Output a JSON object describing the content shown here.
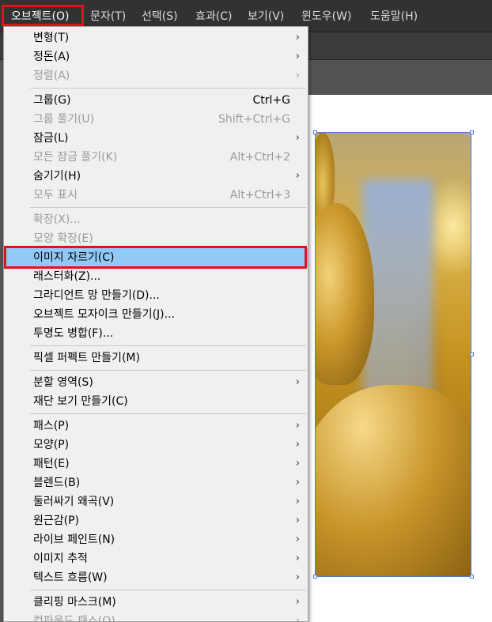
{
  "menubar": {
    "items": [
      {
        "label": "오브젝트(O)"
      },
      {
        "label": "문자(T)"
      },
      {
        "label": "선택(S)"
      },
      {
        "label": "효과(C)"
      },
      {
        "label": "보기(V)"
      },
      {
        "label": "윈도우(W)"
      },
      {
        "label": "도움말(H)"
      }
    ]
  },
  "object_menu": {
    "items": [
      {
        "label": "변형(T)",
        "shortcut": "",
        "submenu": true,
        "enabled": true
      },
      {
        "label": "정돈(A)",
        "shortcut": "",
        "submenu": true,
        "enabled": true
      },
      {
        "label": "정렬(A)",
        "shortcut": "",
        "submenu": true,
        "enabled": false
      },
      {
        "label": "그룹(G)",
        "shortcut": "Ctrl+G",
        "submenu": false,
        "enabled": true
      },
      {
        "label": "그룹 풀기(U)",
        "shortcut": "Shift+Ctrl+G",
        "submenu": false,
        "enabled": false
      },
      {
        "label": "잠금(L)",
        "shortcut": "",
        "submenu": true,
        "enabled": true
      },
      {
        "label": "모든 잠금 풀기(K)",
        "shortcut": "Alt+Ctrl+2",
        "submenu": false,
        "enabled": false
      },
      {
        "label": "숨기기(H)",
        "shortcut": "",
        "submenu": true,
        "enabled": true
      },
      {
        "label": "모두 표시",
        "shortcut": "Alt+Ctrl+3",
        "submenu": false,
        "enabled": false
      },
      {
        "label": "확장(X)...",
        "shortcut": "",
        "submenu": false,
        "enabled": false
      },
      {
        "label": "모양 확장(E)",
        "shortcut": "",
        "submenu": false,
        "enabled": false
      },
      {
        "label": "이미지 자르기(C)",
        "shortcut": "",
        "submenu": false,
        "enabled": true
      },
      {
        "label": "래스터화(Z)...",
        "shortcut": "",
        "submenu": false,
        "enabled": true
      },
      {
        "label": "그라디언트 망 만들기(D)...",
        "shortcut": "",
        "submenu": false,
        "enabled": true
      },
      {
        "label": "오브젝트 모자이크 만들기(J)...",
        "shortcut": "",
        "submenu": false,
        "enabled": true
      },
      {
        "label": "투명도 병합(F)...",
        "shortcut": "",
        "submenu": false,
        "enabled": true
      },
      {
        "label": "픽셀 퍼펙트 만들기(M)",
        "shortcut": "",
        "submenu": false,
        "enabled": true
      },
      {
        "label": "분할 영역(S)",
        "shortcut": "",
        "submenu": true,
        "enabled": true
      },
      {
        "label": "재단 보기 만들기(C)",
        "shortcut": "",
        "submenu": false,
        "enabled": true
      },
      {
        "label": "패스(P)",
        "shortcut": "",
        "submenu": true,
        "enabled": true
      },
      {
        "label": "모양(P)",
        "shortcut": "",
        "submenu": true,
        "enabled": true
      },
      {
        "label": "패턴(E)",
        "shortcut": "",
        "submenu": true,
        "enabled": true
      },
      {
        "label": "블렌드(B)",
        "shortcut": "",
        "submenu": true,
        "enabled": true
      },
      {
        "label": "둘러싸기 왜곡(V)",
        "shortcut": "",
        "submenu": true,
        "enabled": true
      },
      {
        "label": "원근감(P)",
        "shortcut": "",
        "submenu": true,
        "enabled": true
      },
      {
        "label": "라이브 페인트(N)",
        "shortcut": "",
        "submenu": true,
        "enabled": true
      },
      {
        "label": "이미지 추적",
        "shortcut": "",
        "submenu": true,
        "enabled": true
      },
      {
        "label": "텍스트 흐름(W)",
        "shortcut": "",
        "submenu": true,
        "enabled": true
      },
      {
        "label": "클리핑 마스크(M)",
        "shortcut": "",
        "submenu": true,
        "enabled": true
      },
      {
        "label": "컴파운드 패스(O)",
        "shortcut": "",
        "submenu": true,
        "enabled": false
      }
    ]
  },
  "colors": {
    "highlight": "#91c9f7",
    "annotation": "#e0141a",
    "selection": "#4a7bd8"
  }
}
